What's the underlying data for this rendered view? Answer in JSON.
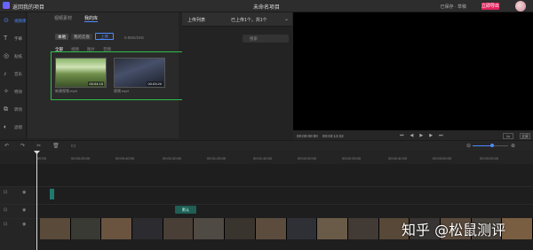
{
  "topbar": {
    "project_title": "返回我的项目",
    "center_title": "未命名项目",
    "status_text": "已保存 · 草稿",
    "export_label": "立即导出"
  },
  "sidebar": {
    "items": [
      {
        "label": "视频库",
        "icon": "film-icon"
      },
      {
        "label": "字幕",
        "icon": "text-icon"
      },
      {
        "label": "贴纸",
        "icon": "sticker-icon"
      },
      {
        "label": "音乐",
        "icon": "music-icon"
      },
      {
        "label": "特效",
        "icon": "effects-icon"
      },
      {
        "label": "转场",
        "icon": "transition-icon"
      },
      {
        "label": "滤镜",
        "icon": "filter-icon"
      }
    ]
  },
  "media": {
    "tabs": [
      "视频素材",
      "我的库"
    ],
    "active_tab": "我的库",
    "filters": [
      "本地",
      "我的云盘"
    ],
    "upload_label": "上传",
    "storage": "0.08G/10G",
    "categories": [
      "全部",
      "视频",
      "图片",
      "音频"
    ],
    "items": [
      {
        "name": "新建视频.mp4",
        "duration": "00:04:15"
      },
      {
        "name": "视频.mp4",
        "duration": "00:03:20"
      }
    ]
  },
  "upload_panel": {
    "title": "上传列表",
    "count": "已上传1个，共1个",
    "search_placeholder": "搜索"
  },
  "preview": {
    "timecode_current": "00:00:00:00",
    "timecode_total": "00:03:13:22",
    "rate": "1x",
    "fullscreen": "全屏"
  },
  "ruler": {
    "ticks": [
      "00:00",
      "00:00:25:00",
      "00:00:40:00",
      "00:01:00:00",
      "00:01:25:00",
      "00:01:40:00",
      "00:02:00:00",
      "00:02:25:00",
      "00:02:40:00",
      "00:03:00:00",
      "00:03:25:00"
    ]
  },
  "timeline": {
    "subtitle_clip": "默认"
  },
  "watermark": {
    "text": "知乎 @松鼠测评"
  }
}
